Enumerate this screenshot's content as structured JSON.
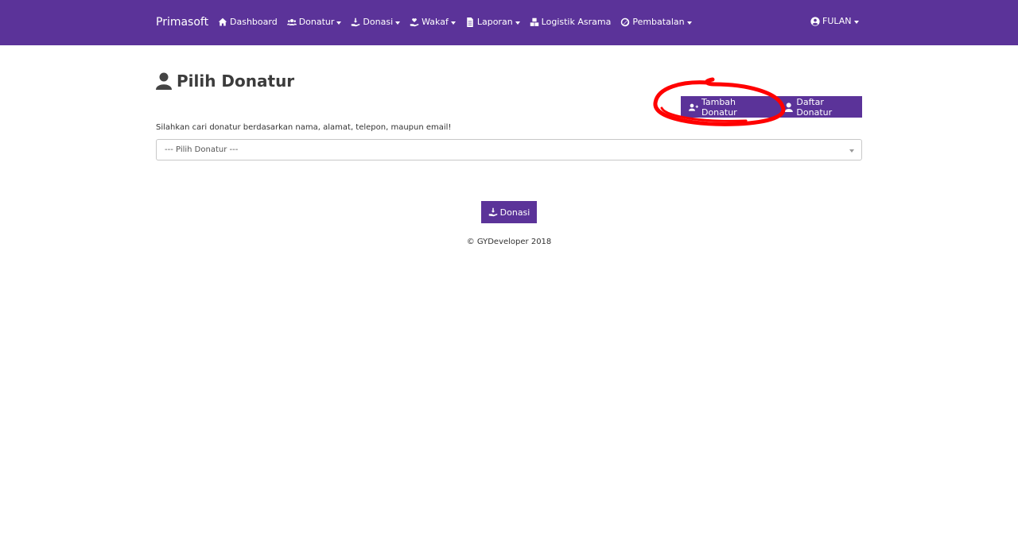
{
  "navbar": {
    "brand": "Primasoft",
    "items": [
      {
        "label": "Dashboard",
        "icon": "home-icon",
        "dropdown": false
      },
      {
        "label": "Donatur",
        "icon": "users-icon",
        "dropdown": true
      },
      {
        "label": "Donasi",
        "icon": "hand-coin-icon",
        "dropdown": true
      },
      {
        "label": "Wakaf",
        "icon": "hand-heart-icon",
        "dropdown": true
      },
      {
        "label": "Laporan",
        "icon": "file-icon",
        "dropdown": true
      },
      {
        "label": "Logistik Asrama",
        "icon": "boxes-icon",
        "dropdown": false
      },
      {
        "label": "Pembatalan",
        "icon": "ban-icon",
        "dropdown": true
      }
    ],
    "user": {
      "label": "FULAN",
      "icon": "user-circle-icon"
    }
  },
  "page": {
    "title": "Pilih Donatur",
    "title_icon": "user-icon",
    "buttons": {
      "tambah": "Tambah Donatur",
      "daftar": "Daftar Donatur"
    },
    "hint": "Silahkan cari donatur berdasarkan nama, alamat, telepon, maupun email!",
    "select_value": "--- Pilih Donatur ---",
    "donasi_button": "Donasi"
  },
  "footer": {
    "text": "© GYDeveloper 2018"
  },
  "colors": {
    "brand": "#5b3399",
    "annotation": "#ff0000"
  }
}
